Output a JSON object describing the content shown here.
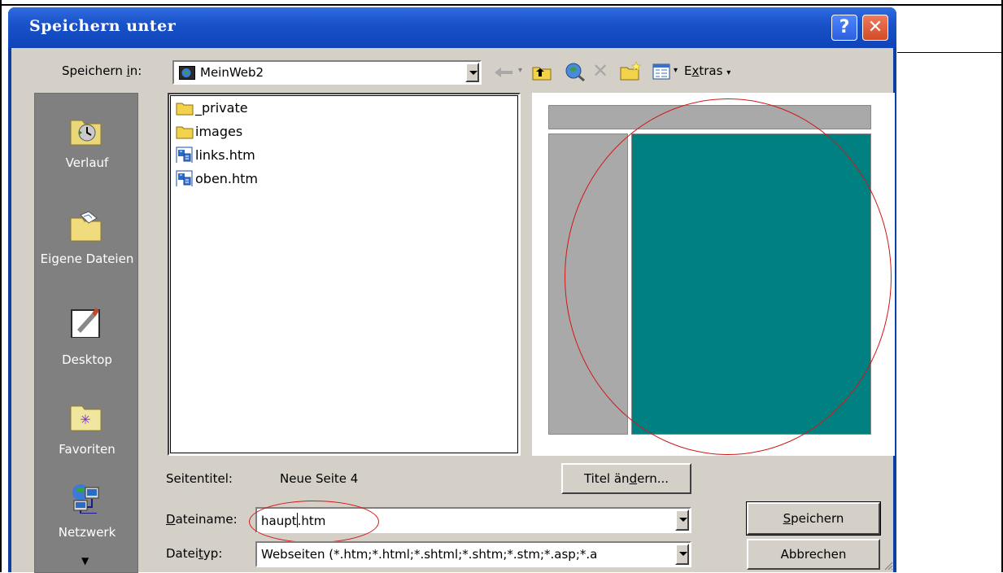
{
  "dialog": {
    "title": "Speichern unter",
    "help_glyph": "?",
    "close_glyph": "✕"
  },
  "save_in": {
    "label_pre": "Speichern ",
    "label_ul": "i",
    "label_post": "n:",
    "value": "MeinWeb2"
  },
  "toolbar": {
    "extras_pre": "E",
    "extras_ul": "x",
    "extras_post": "tras",
    "icons": [
      "back-arrow-icon",
      "up-folder-icon",
      "search-web-icon",
      "delete-icon",
      "new-folder-icon",
      "views-icon"
    ]
  },
  "places": [
    {
      "label": "Verlauf",
      "icon": "history-icon"
    },
    {
      "label": "Eigene Dateien",
      "icon": "my-documents-icon"
    },
    {
      "label": "Desktop",
      "icon": "desktop-icon"
    },
    {
      "label": "Favoriten",
      "icon": "favorites-icon"
    },
    {
      "label": "Netzwerk",
      "icon": "network-icon"
    }
  ],
  "files": [
    {
      "name": "_private",
      "type": "folder"
    },
    {
      "name": "images",
      "type": "folder"
    },
    {
      "name": "links.htm",
      "type": "htm"
    },
    {
      "name": "oben.htm",
      "type": "htm"
    }
  ],
  "page_title": {
    "label": "Seitentitel:",
    "value": "Neue Seite 4",
    "change_button_pre": "Titel än",
    "change_button_ul": "d",
    "change_button_post": "ern..."
  },
  "filename": {
    "label_ul": "D",
    "label_post": "ateiname:",
    "value_before_caret": "haupt",
    "value_after_caret": ".htm"
  },
  "filetype": {
    "label_pre": "Datei",
    "label_ul": "t",
    "label_post": "yp:",
    "value": "Webseiten (*.htm;*.html;*.shtml;*.shtm;*.stm;*.asp;*.a"
  },
  "buttons": {
    "save_ul": "S",
    "save_post": "peichern",
    "cancel": "Abbrechen"
  },
  "colors": {
    "titlebar": "#1a52c9",
    "dialog_face": "#d4d0c8",
    "preview_frame": "#008080",
    "annotation": "#d01818"
  }
}
